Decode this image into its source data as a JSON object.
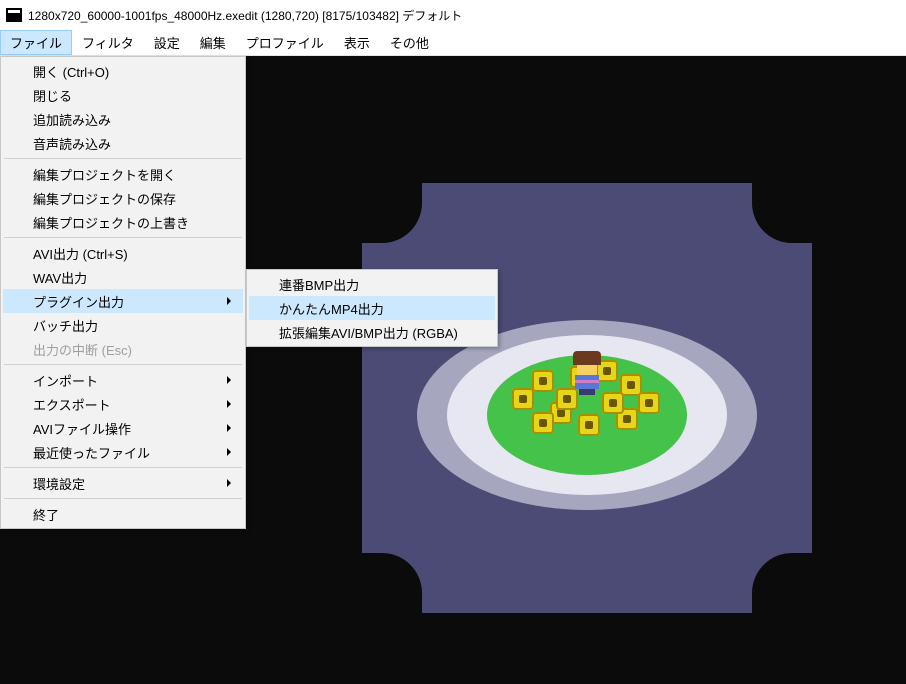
{
  "title": "1280x720_60000-1001fps_48000Hz.exedit (1280,720)  [8175/103482]  デフォルト",
  "menubar": [
    "ファイル",
    "フィルタ",
    "設定",
    "編集",
    "プロファイル",
    "表示",
    "その他"
  ],
  "menubar_active_index": 0,
  "file_menu": {
    "groups": [
      [
        {
          "label": "開く (Ctrl+O)",
          "sub": false,
          "disabled": false
        },
        {
          "label": "閉じる",
          "sub": false,
          "disabled": false
        },
        {
          "label": "追加読み込み",
          "sub": false,
          "disabled": false
        },
        {
          "label": "音声読み込み",
          "sub": false,
          "disabled": false
        }
      ],
      [
        {
          "label": "編集プロジェクトを開く",
          "sub": false,
          "disabled": false
        },
        {
          "label": "編集プロジェクトの保存",
          "sub": false,
          "disabled": false
        },
        {
          "label": "編集プロジェクトの上書き",
          "sub": false,
          "disabled": false
        }
      ],
      [
        {
          "label": "AVI出力 (Ctrl+S)",
          "sub": false,
          "disabled": false
        },
        {
          "label": "WAV出力",
          "sub": false,
          "disabled": false
        },
        {
          "label": "プラグイン出力",
          "sub": true,
          "disabled": false,
          "hover": true
        },
        {
          "label": "バッチ出力",
          "sub": false,
          "disabled": false
        },
        {
          "label": "出力の中断 (Esc)",
          "sub": false,
          "disabled": true
        }
      ],
      [
        {
          "label": "インポート",
          "sub": true,
          "disabled": false
        },
        {
          "label": "エクスポート",
          "sub": true,
          "disabled": false
        },
        {
          "label": "AVIファイル操作",
          "sub": true,
          "disabled": false
        },
        {
          "label": "最近使ったファイル",
          "sub": true,
          "disabled": false
        }
      ],
      [
        {
          "label": "環境設定",
          "sub": true,
          "disabled": false
        }
      ],
      [
        {
          "label": "終了",
          "sub": false,
          "disabled": false
        }
      ]
    ]
  },
  "plugin_submenu": [
    {
      "label": "連番BMP出力",
      "hover": false
    },
    {
      "label": "かんたんMP4出力",
      "hover": true
    },
    {
      "label": "拡張編集AVI/BMP出力 (RGBA)",
      "hover": false
    }
  ]
}
